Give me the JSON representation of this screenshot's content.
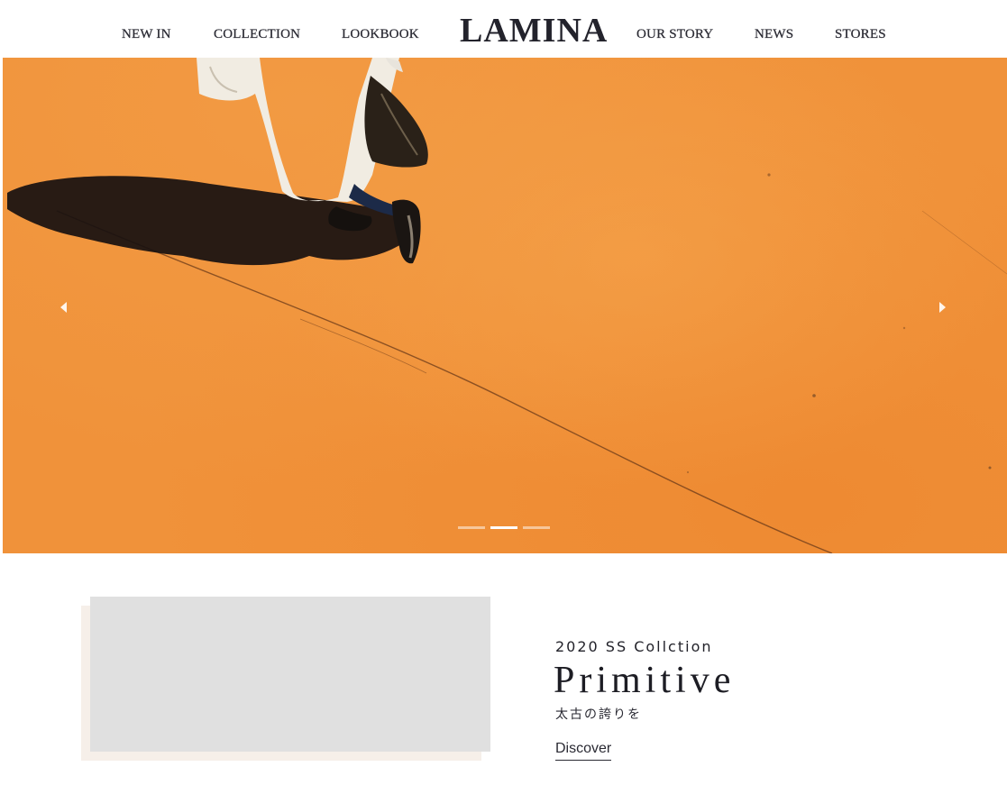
{
  "header": {
    "logo": "LAMINA",
    "nav_left": [
      "NEW IN",
      "COLLECTION",
      "LOOKBOOK"
    ],
    "nav_right": [
      "OUR STORY",
      "NEWS",
      "STORES"
    ]
  },
  "hero": {
    "prev_label": "Previous",
    "next_label": "Next",
    "slide_count": 3,
    "active_slide": 2,
    "colors": {
      "ground": "#f0923a",
      "indicator": "#ffffff"
    }
  },
  "collection": {
    "season": "2020 SS Collction",
    "title": "Primitive",
    "subtitle": "太古の誇りを",
    "cta": "Discover"
  }
}
